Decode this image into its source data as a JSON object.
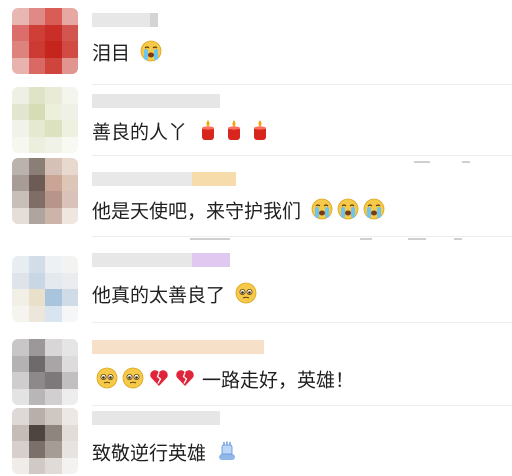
{
  "comments": [
    {
      "text": "泪目",
      "emojis": [
        "crying-face"
      ],
      "avatar_colors": [
        "#e9b7b2",
        "#df8a86",
        "#d95c57",
        "#e7a8a4",
        "#db6e6a",
        "#cf3e37",
        "#c92f28",
        "#d35550",
        "#de827d",
        "#cd3a33",
        "#c6251e",
        "#d24a44",
        "#e8b3ae",
        "#da6964",
        "#d0443e",
        "#e09590"
      ]
    },
    {
      "text": "善良的人丫",
      "emojis": [
        "candle",
        "candle",
        "candle"
      ],
      "avatar_colors": [
        "#eef0e4",
        "#dfe4c8",
        "#e9ebd6",
        "#f4f5ec",
        "#e2e6ce",
        "#d6dcb5",
        "#ecefd9",
        "#f0f1e6",
        "#f2f3e8",
        "#e5e9cf",
        "#dce1bf",
        "#eef0e0",
        "#f6f7ef",
        "#ecefdd",
        "#f1f2e7",
        "#f8f9f2"
      ]
    },
    {
      "text": "他是天使吧，来守护我们",
      "emojis": [
        "crying-face",
        "crying-face",
        "crying-face"
      ],
      "avatar_colors": [
        "#b9b2ad",
        "#8b7e77",
        "#d6c1b7",
        "#e8d9cf",
        "#a79c96",
        "#6d5c55",
        "#caa595",
        "#ddc5b8",
        "#c8bfb9",
        "#7f6e66",
        "#b8958a",
        "#d8c2b9",
        "#e5ddd8",
        "#b0a49e",
        "#ccb4aa",
        "#efe6e0"
      ]
    },
    {
      "text": "他真的太善良了",
      "emojis": [
        "pleading-face"
      ],
      "avatar_colors": [
        "#e8edf2",
        "#d3dde8",
        "#eef1f4",
        "#f3f4f2",
        "#dfe4ea",
        "#c9d6e4",
        "#e4e9ef",
        "#eaecef",
        "#f1efe6",
        "#e9e0c9",
        "#a9c4dd",
        "#cfdce8",
        "#f5f4ef",
        "#ece7da",
        "#d8e4ef",
        "#f4f6f8"
      ]
    },
    {
      "text": "一路走好，英雄！",
      "emojis": [
        "pleading-face",
        "pleading-face",
        "broken-heart",
        "broken-heart"
      ],
      "avatar_colors": [
        "#c8c6c7",
        "#9c9899",
        "#d8d6d7",
        "#e6e5e5",
        "#b5b2b3",
        "#6e6a6b",
        "#a9a5a6",
        "#dddbdb",
        "#cfcdcd",
        "#8d898a",
        "#7d797a",
        "#c2bfc0",
        "#e4e3e3",
        "#b9b6b7",
        "#d1cfcf",
        "#ededed"
      ]
    },
    {
      "text": "致敬逆行英雄",
      "emojis": [
        "salute-hand"
      ],
      "avatar_colors": [
        "#ded9d6",
        "#b8afaa",
        "#cfc7c2",
        "#ebe8e6",
        "#c5bcb7",
        "#4f4540",
        "#8f857f",
        "#e2ddd9",
        "#d6cfcb",
        "#7b706a",
        "#a69c96",
        "#e7e3e0",
        "#efece9",
        "#d1c9c5",
        "#e0dbd7",
        "#f4f2f0"
      ]
    }
  ]
}
